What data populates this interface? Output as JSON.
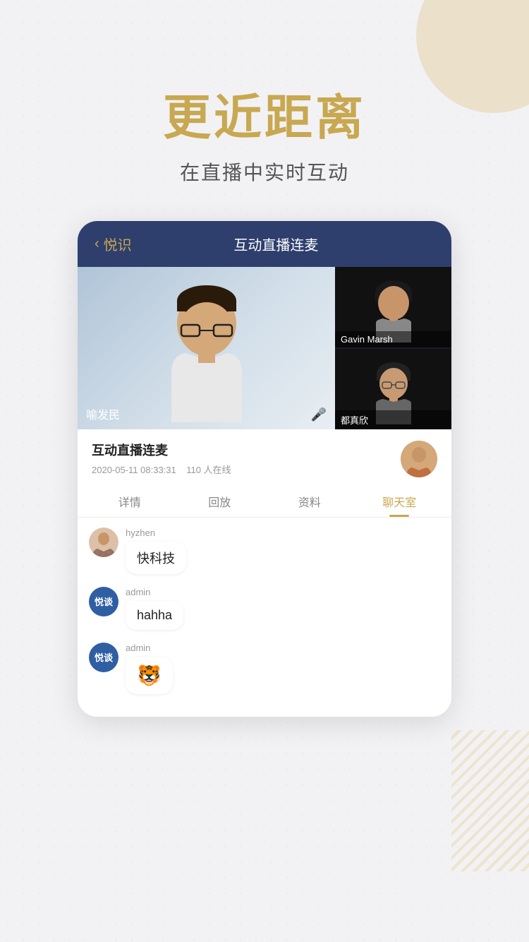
{
  "background": {
    "dotted": true
  },
  "heading": {
    "main_title": "更近距离",
    "sub_title": "在直播中实时互动"
  },
  "card": {
    "header": {
      "back_label": "悦识",
      "nav_title": "互动直播连麦"
    },
    "video": {
      "main_person_name": "喻发民",
      "has_mic": true,
      "side_persons": [
        {
          "name": "Gavin Marsh"
        },
        {
          "name": "都真欣"
        }
      ]
    },
    "info": {
      "title": "互动直播连麦",
      "datetime": "2020-05-11 08:33:31",
      "online_count": "110 人在线"
    },
    "tabs": [
      {
        "label": "详情",
        "active": false
      },
      {
        "label": "回放",
        "active": false
      },
      {
        "label": "资料",
        "active": false
      },
      {
        "label": "聊天室",
        "active": true
      }
    ],
    "chat": {
      "messages": [
        {
          "id": "msg1",
          "username": "hyzhen",
          "avatar_type": "photo",
          "content": "快科技",
          "type": "text"
        },
        {
          "id": "msg2",
          "username": "admin",
          "avatar_type": "badge",
          "badge_text": "悦谈",
          "content": "hahha",
          "type": "text"
        },
        {
          "id": "msg3",
          "username": "admin",
          "avatar_type": "badge",
          "badge_text": "悦谈",
          "content": "🐯",
          "type": "emoji"
        }
      ]
    }
  }
}
